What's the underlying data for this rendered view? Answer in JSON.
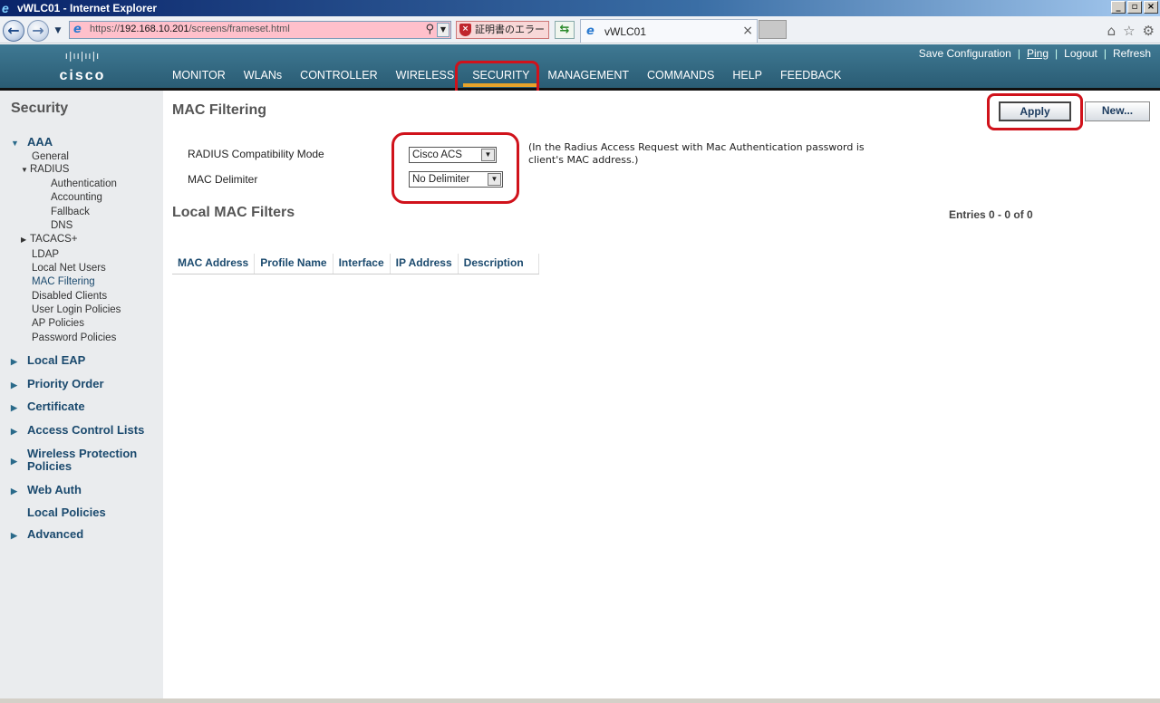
{
  "window": {
    "title": "vWLC01 - Internet Explorer",
    "controls": [
      "_",
      "▫",
      "×"
    ]
  },
  "addressbar": {
    "url_prefix": "https://",
    "url_host": "192.168.10.201",
    "url_path": "/screens/frameset.html",
    "cert_error": "証明書のエラー",
    "tab_title": "vWLC01"
  },
  "header": {
    "logo_bars": "ı|ıı|ıı|ı",
    "logo_text": "cisco",
    "toplinks": {
      "save": "Save Configuration",
      "ping": "Ping",
      "logout": "Logout",
      "refresh": "Refresh"
    },
    "nav": [
      {
        "label": "MONITOR"
      },
      {
        "label": "WLANs"
      },
      {
        "label": "CONTROLLER"
      },
      {
        "label": "WIRELESS"
      },
      {
        "label": "SECURITY"
      },
      {
        "label": "MANAGEMENT"
      },
      {
        "label": "COMMANDS"
      },
      {
        "label": "HELP"
      },
      {
        "label": "FEEDBACK"
      }
    ],
    "active_nav": "SECURITY"
  },
  "sidebar": {
    "title": "Security",
    "aaa": {
      "label": "AAA",
      "general": "General",
      "radius": "RADIUS",
      "radius_items": [
        "Authentication",
        "Accounting",
        "Fallback",
        "DNS"
      ],
      "tacacs": "TACACS+",
      "items": [
        "LDAP",
        "Local Net Users",
        "MAC Filtering",
        "Disabled Clients",
        "User Login Policies",
        "AP Policies",
        "Password Policies"
      ]
    },
    "sections": [
      "Local EAP",
      "Priority Order",
      "Certificate",
      "Access Control Lists",
      "Wireless Protection",
      "Policies",
      "Web Auth",
      "Local Policies",
      "Advanced"
    ]
  },
  "main": {
    "title": "MAC Filtering",
    "apply": "Apply",
    "new": "New...",
    "radius_mode_label": "RADIUS Compatibility Mode",
    "radius_mode_value": "Cisco ACS",
    "delimiter_label": "MAC Delimiter",
    "delimiter_value": "No Delimiter",
    "note_line1": "(In the Radius Access Request with Mac Authentication password is",
    "note_line2": "client's MAC address.)",
    "filters_title": "Local MAC Filters",
    "entries": "Entries 0 - 0 of 0",
    "columns": [
      "MAC Address",
      "Profile Name",
      "Interface",
      "IP Address",
      "Description"
    ]
  },
  "colors": {
    "header": "#2a5c74",
    "accent": "#e8a32a",
    "highlight": "#d0121b"
  }
}
